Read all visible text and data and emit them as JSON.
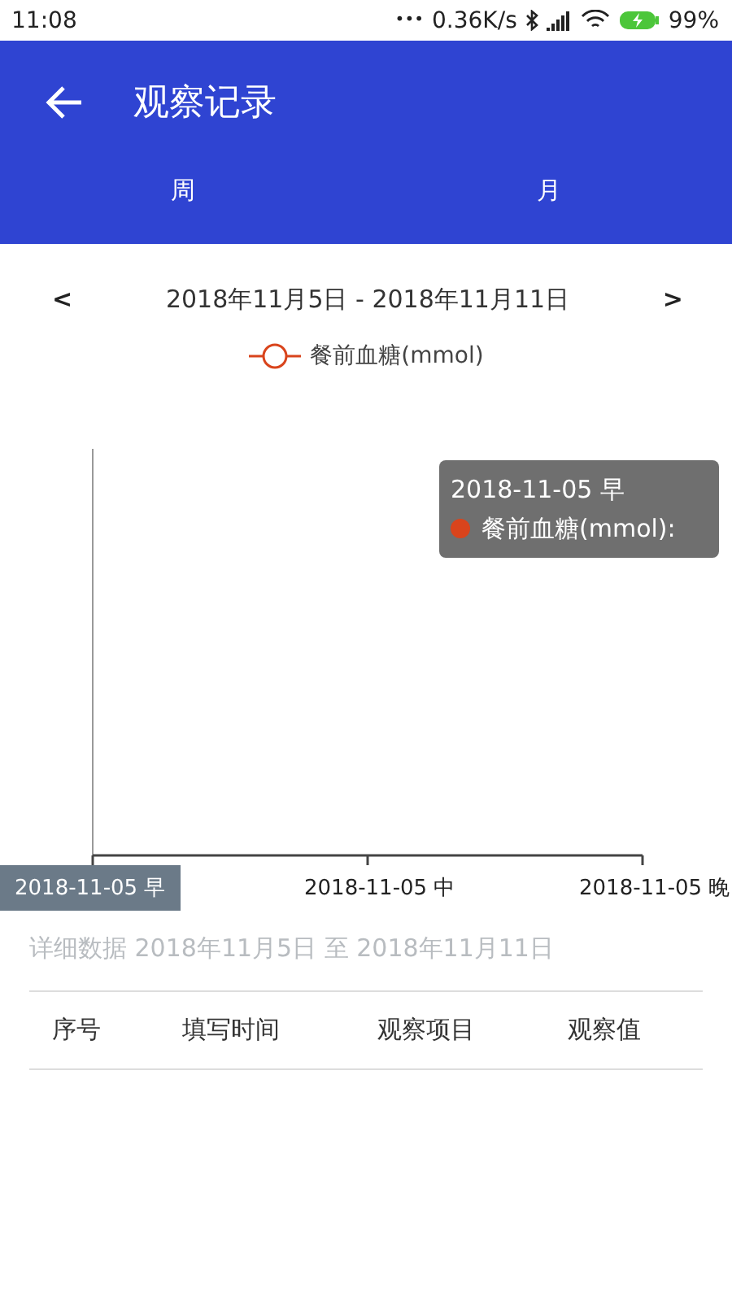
{
  "status_bar": {
    "time": "11:08",
    "dots": "•••",
    "speed": "0.36K/s",
    "battery": "99%"
  },
  "header": {
    "title": "观察记录",
    "tabs": [
      {
        "label": "周"
      },
      {
        "label": "月"
      }
    ]
  },
  "date_nav": {
    "prev": "<",
    "range": "2018年11月5日 - 2018年11月11日",
    "next": ">"
  },
  "chart": {
    "legend": {
      "label": "餐前血糖(mmol)",
      "color": "#d9441c"
    },
    "x_labels": [
      {
        "label": "2018-11-05 早",
        "selected": true
      },
      {
        "label": "2018-11-05 中",
        "selected": false
      },
      {
        "label": "2018-11-05 晚",
        "selected": false
      }
    ],
    "tooltip": {
      "title": "2018-11-05 早",
      "series": "餐前血糖(mmol):",
      "color": "#d9441c"
    }
  },
  "detail": {
    "caption": "详细数据 2018年11月5日 至 2018年11月11日",
    "columns": [
      "序号",
      "填写时间",
      "观察项目",
      "观察值"
    ]
  }
}
